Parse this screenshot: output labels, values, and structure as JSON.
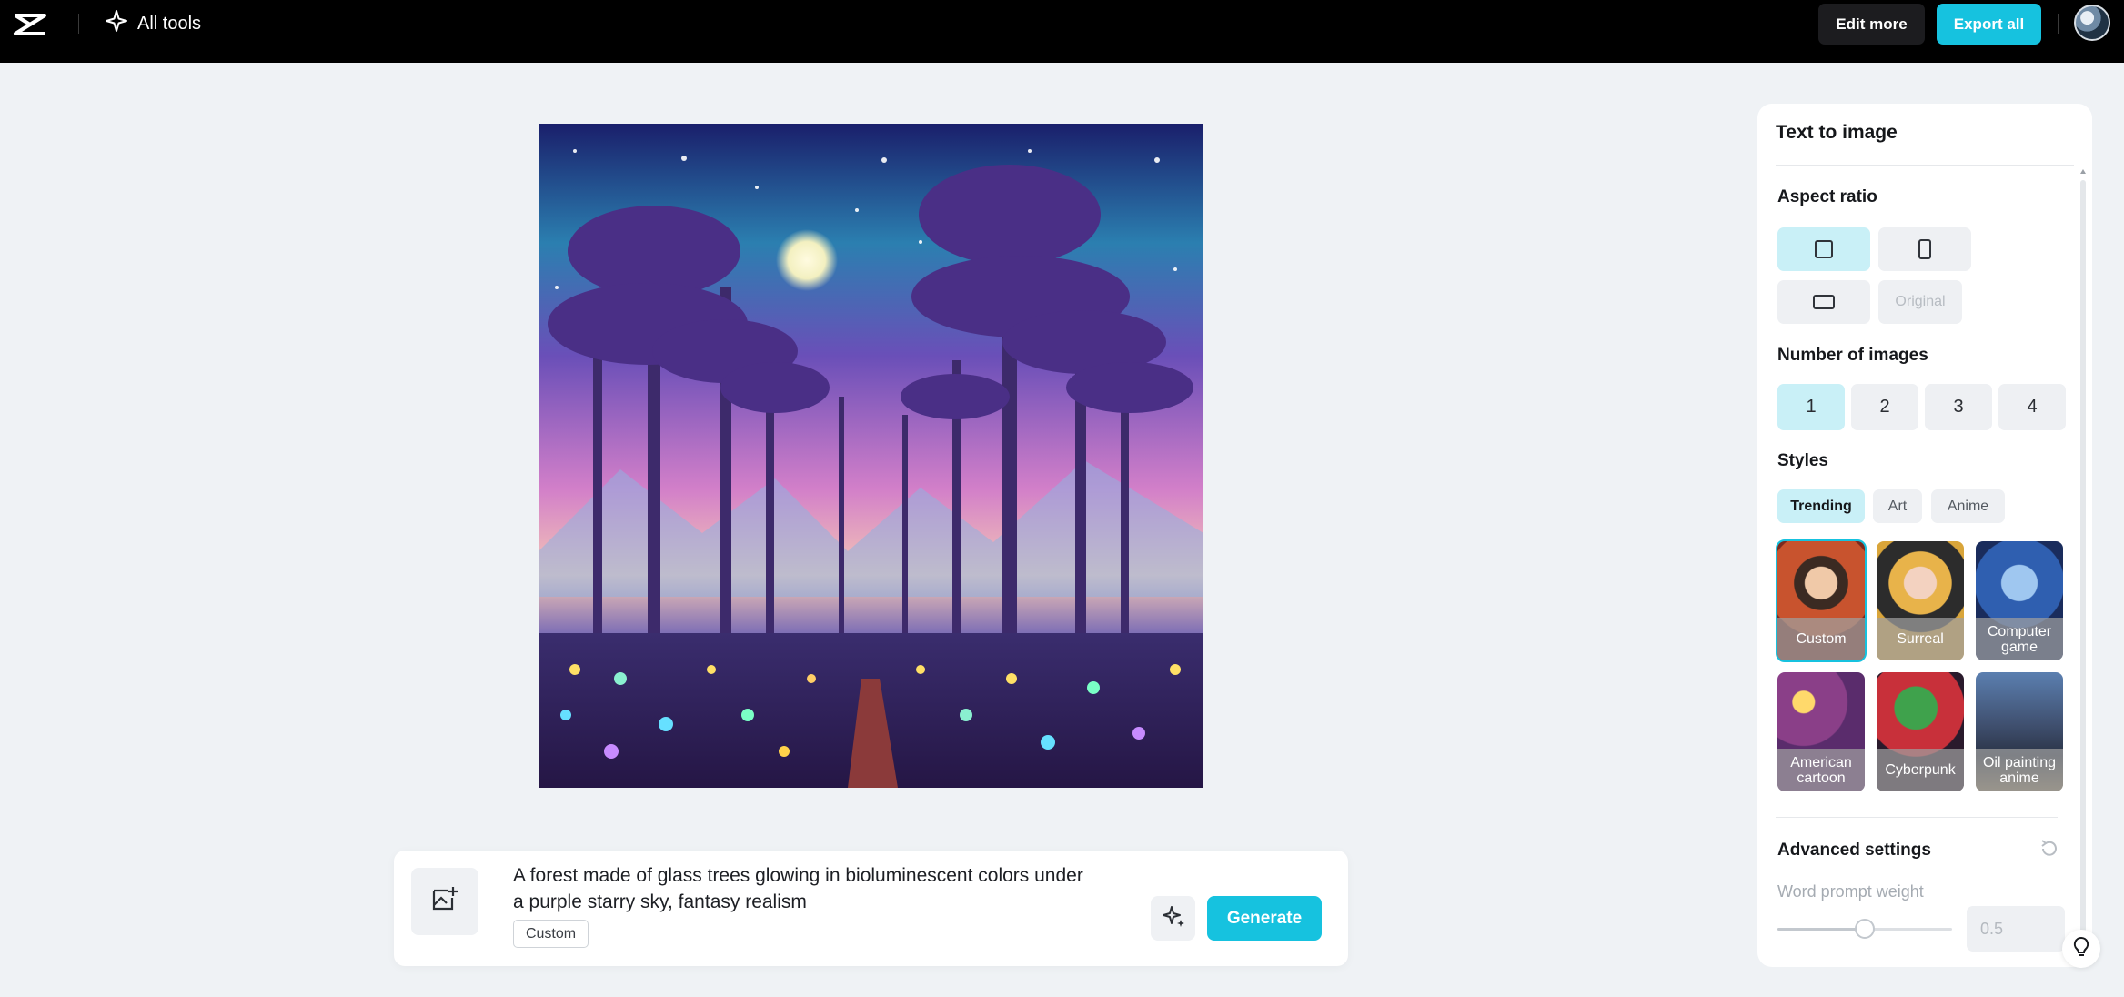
{
  "topbar": {
    "all_tools_label": "All tools",
    "edit_more_label": "Edit more",
    "export_all_label": "Export all"
  },
  "prompt": {
    "text": "A forest made of glass trees glowing in bioluminescent colors under a purple starry sky, fantasy realism",
    "style_tag": "Custom",
    "generate_label": "Generate"
  },
  "panel": {
    "title": "Text to image",
    "aspect_ratio_label": "Aspect ratio",
    "aspect_ratio_options": [
      "square",
      "portrait",
      "landscape"
    ],
    "aspect_ratio_selected": "square",
    "original_label": "Original",
    "number_label": "Number of images",
    "number_options": [
      "1",
      "2",
      "3",
      "4"
    ],
    "number_selected": "1",
    "styles_label": "Styles",
    "style_tabs": [
      "Trending",
      "Art",
      "Anime"
    ],
    "style_tab_selected": "Trending",
    "style_cards": [
      "Custom",
      "Surreal",
      "Computer game",
      "American cartoon",
      "Cyberpunk",
      "Oil painting anime"
    ],
    "style_card_selected": "Custom",
    "advanced_label": "Advanced settings",
    "word_prompt_weight_label": "Word prompt weight",
    "word_prompt_weight_value": "0.5",
    "word_prompt_weight_slider_fraction": 0.5
  },
  "colors": {
    "accent": "#16c2df",
    "selected_bg": "#c9f0f7",
    "topbar_bg": "#000000",
    "page_bg": "#eff2f5"
  },
  "icons": {
    "logo": "capcut-logo-icon",
    "all_tools": "sparkle-icon",
    "image_upload": "image-add-icon",
    "magic": "magic-sparkle-icon",
    "reset": "reset-icon",
    "help": "lightbulb-icon"
  }
}
